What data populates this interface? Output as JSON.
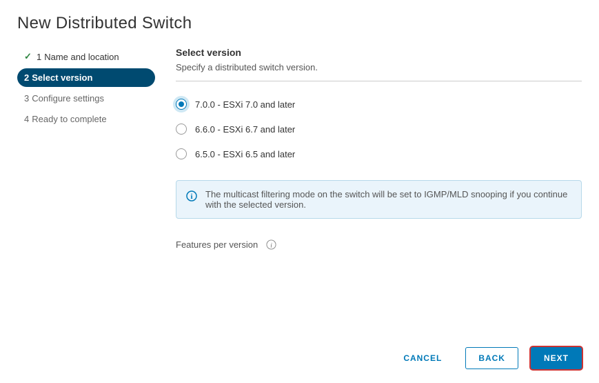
{
  "dialog": {
    "title": "New Distributed Switch"
  },
  "wizard": {
    "steps": [
      {
        "num": "1",
        "label": "Name and location"
      },
      {
        "num": "2",
        "label": "Select version"
      },
      {
        "num": "3",
        "label": "Configure settings"
      },
      {
        "num": "4",
        "label": "Ready to complete"
      }
    ]
  },
  "main": {
    "section_title": "Select version",
    "section_desc": "Specify a distributed switch version.",
    "options": [
      {
        "label": "7.0.0 - ESXi 7.0 and later",
        "selected": true
      },
      {
        "label": "6.6.0 - ESXi 6.7 and later",
        "selected": false
      },
      {
        "label": "6.5.0 - ESXi 6.5 and later",
        "selected": false
      }
    ],
    "info_text": "The multicast filtering mode on the switch will be set to IGMP/MLD snooping if you continue with the selected version.",
    "features_label": "Features per version"
  },
  "footer": {
    "cancel": "CANCEL",
    "back": "BACK",
    "next": "NEXT"
  }
}
